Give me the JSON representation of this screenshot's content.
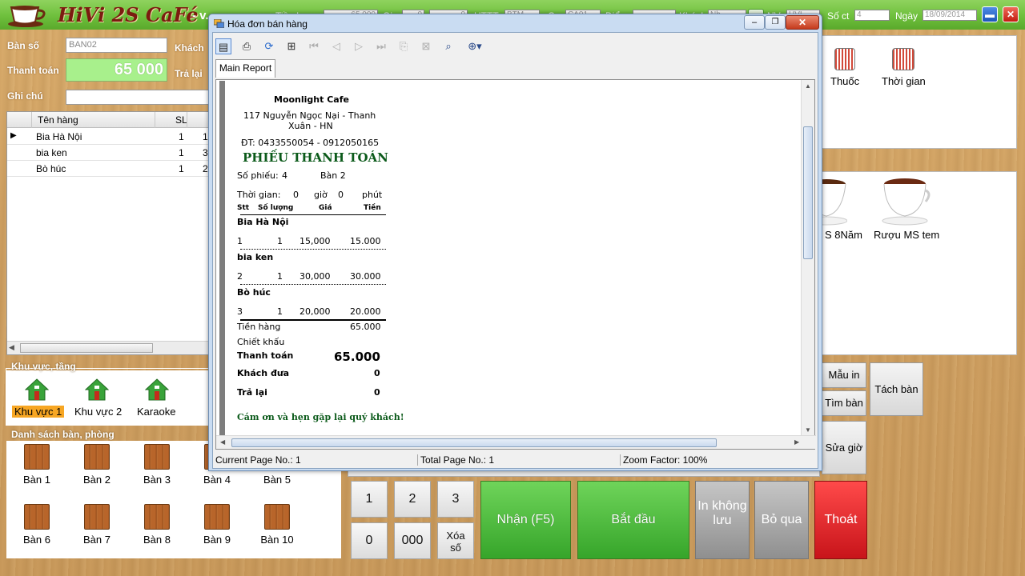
{
  "app": {
    "title": "HiVi 2S CaFé",
    "subtitle": "- v...",
    "brand_color": "#7b1c10"
  },
  "topbar": {
    "fields": [
      {
        "label": "Tiền h...",
        "value": "65 000"
      },
      {
        "label": "Gi...",
        "value": "0"
      },
      {
        "label": "",
        "value": "0"
      },
      {
        "label": "HTTT",
        "value": "BTM"
      },
      {
        "label": "C...",
        "value": "CA01"
      },
      {
        "label": "Điể...",
        "value": ""
      },
      {
        "label": "Khách",
        "value": "Nh..."
      },
      {
        "label": "NV",
        "value": "HVI"
      }
    ],
    "soct_label": "Số ct",
    "soct_value": "4",
    "date_label": "Ngày",
    "date_value": "18/09/2014",
    "minimize_icon": "minimize-icon",
    "close_icon": "close-icon"
  },
  "left": {
    "ban_so_label": "Bàn số",
    "ban_so_value": "BAN02",
    "khach_label": "Khách",
    "thanh_toan_label": "Thanh toán",
    "thanh_toan_value": "65 000",
    "tra_lai_label": "Trả lại",
    "ghi_chu_label": "Ghi chú",
    "ghi_chu_value": "",
    "grid": {
      "columns": [
        "Tên hàng",
        "SL",
        ""
      ],
      "rows": [
        {
          "name": "Bia Hà Nội",
          "qty": "1",
          "price": "1"
        },
        {
          "name": "bia ken",
          "qty": "1",
          "price": "3"
        },
        {
          "name": "Bò húc",
          "qty": "1",
          "price": "2"
        }
      ]
    }
  },
  "areas": {
    "title": "Khu vực, tầng",
    "items": [
      "Khu vực 1",
      "Khu vực 2",
      "Karaoke"
    ],
    "selected": "Khu vực 1"
  },
  "tables": {
    "title": "Danh sách bàn, phòng",
    "items": [
      "Bàn 1",
      "Bàn 2",
      "Bàn 3",
      "Bàn 4",
      "Bàn 5",
      "Bàn 6",
      "Bàn 7",
      "Bàn 8",
      "Bàn 9",
      "Bàn 10"
    ]
  },
  "categories": {
    "items": [
      "Thuốc",
      "Thời gian"
    ]
  },
  "products": {
    "items": [
      "S 8Năm",
      "Rượu MS tem"
    ]
  },
  "side_buttons": {
    "mau_in": "Mẫu in",
    "tim_ban": "Tìm bàn",
    "tach_ban": "Tách bàn",
    "sua_gio": "Sửa giờ"
  },
  "numpad": {
    "keys": [
      "1",
      "2",
      "3",
      "0",
      "000",
      "Xóa số"
    ]
  },
  "actions": {
    "nhan": "Nhận (F5)",
    "bat_dau": "Bắt đầu",
    "in_khong_luu": "In không lưu",
    "bo_qua": "Bỏ qua",
    "thoat": "Thoát"
  },
  "dialog": {
    "title": "Hóa đơn bán hàng",
    "tab": "Main Report",
    "status_current": "Current Page No.: 1",
    "status_total": "Total Page No.: 1",
    "status_zoom": "Zoom Factor: 100%"
  },
  "receipt": {
    "shop": "Moonlight Cafe",
    "address1": "117 Nguyễn Ngọc Nại - Thanh",
    "address2": "Xuân - HN",
    "phone": "ĐT: 0433550054 - 0912050165",
    "heading": "PHIẾU THANH TOÁN",
    "so_phieu_label": "Số phiếu:",
    "so_phieu_value": "4",
    "ban": "Bàn 2",
    "thoi_gian_label": "Thời gian:",
    "hours": "0",
    "gio_label": "giờ",
    "minutes": "0",
    "phut_label": "phút",
    "headers": {
      "stt": "Stt",
      "qty": "Số lượng",
      "price": "Giá",
      "amount": "Tiền"
    },
    "lines": [
      {
        "name": "Bia Hà Nội",
        "stt": "1",
        "qty": "1",
        "price": "15,000",
        "amount": "15.000"
      },
      {
        "name": "bia ken",
        "stt": "2",
        "qty": "1",
        "price": "30,000",
        "amount": "30.000"
      },
      {
        "name": "Bò húc",
        "stt": "3",
        "qty": "1",
        "price": "20,000",
        "amount": "20.000"
      }
    ],
    "tien_hang_label": "Tiền hàng",
    "tien_hang_value": "65.000",
    "chiet_khau_label": "Chiết khấu",
    "thanh_toan_label": "Thanh toán",
    "thanh_toan_value": "65.000",
    "khach_dua_label": "Khách đưa",
    "khach_dua_value": "0",
    "tra_lai_label": "Trả lại",
    "tra_lai_value": "0",
    "thanks": "Cám ơn và hẹn gặp lại quý khách!"
  }
}
